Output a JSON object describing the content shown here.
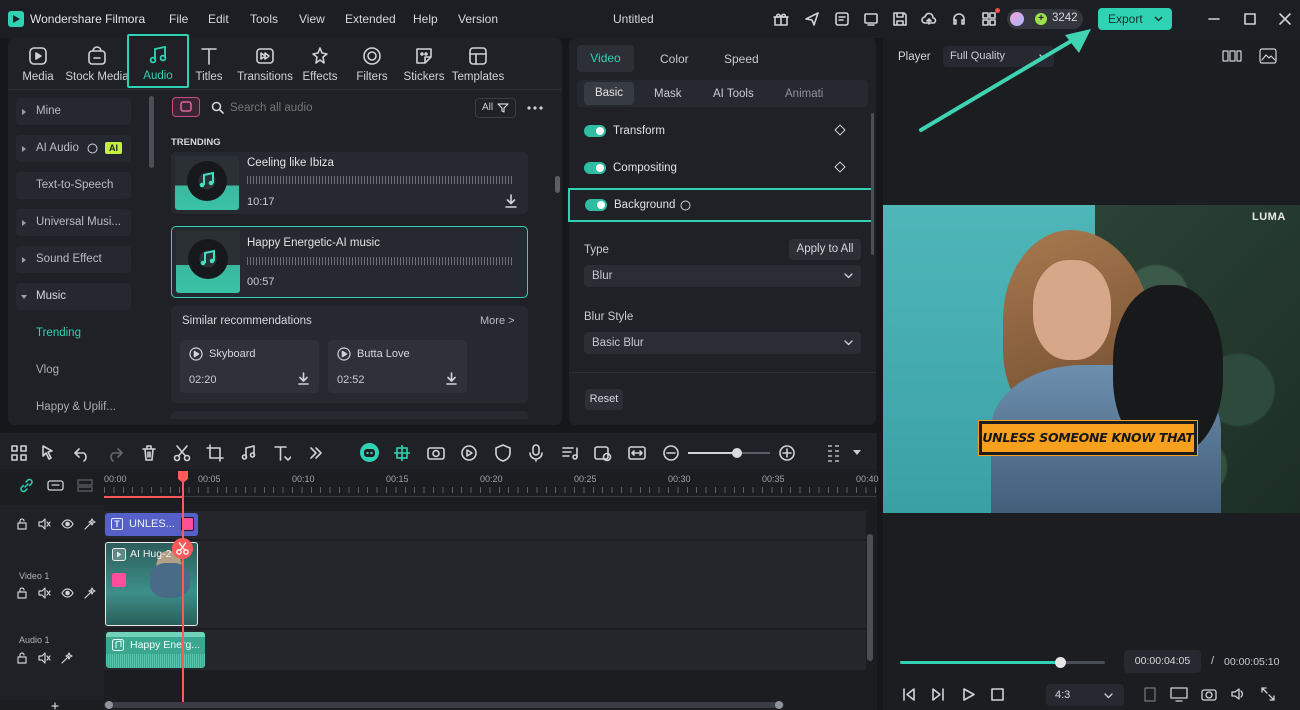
{
  "app": {
    "name": "Wondershare Filmora",
    "project_title": "Untitled",
    "credits": "3242",
    "export_label": "Export"
  },
  "menu": [
    "File",
    "Edit",
    "Tools",
    "View",
    "Extended",
    "Help",
    "Version"
  ],
  "toolbar": [
    {
      "label": "Media",
      "icon": "media-icon"
    },
    {
      "label": "Stock Media",
      "icon": "stock-media-icon"
    },
    {
      "label": "Audio",
      "icon": "music-note-icon",
      "active": true
    },
    {
      "label": "Titles",
      "icon": "text-t-icon"
    },
    {
      "label": "Transitions",
      "icon": "transitions-icon"
    },
    {
      "label": "Effects",
      "icon": "effects-icon"
    },
    {
      "label": "Filters",
      "icon": "filters-icon"
    },
    {
      "label": "Stickers",
      "icon": "stickers-icon"
    },
    {
      "label": "Templates",
      "icon": "templates-icon"
    }
  ],
  "sidebar": {
    "items": [
      {
        "label": "Mine",
        "kind": "collapsed"
      },
      {
        "label": "AI Audio",
        "kind": "collapsed",
        "badge": "AI"
      },
      {
        "label": "Text-to-Speech",
        "kind": "plain"
      },
      {
        "label": "Universal Musi...",
        "kind": "collapsed"
      },
      {
        "label": "Sound Effect",
        "kind": "collapsed"
      },
      {
        "label": "Music",
        "kind": "expanded"
      },
      {
        "label": "Trending",
        "kind": "sub-active"
      },
      {
        "label": "Vlog",
        "kind": "sub"
      },
      {
        "label": "Happy & Uplif...",
        "kind": "sub"
      }
    ]
  },
  "audio_browser": {
    "search_placeholder": "Search all audio",
    "filter_label": "All",
    "section_title": "TRENDING",
    "tracks": [
      {
        "title": "Ceeling like Ibiza",
        "duration": "10:17"
      },
      {
        "title": "Happy Energetic-AI music",
        "duration": "00:57"
      }
    ],
    "similar": {
      "title": "Similar recommendations",
      "more": "More >",
      "items": [
        {
          "title": "Skyboard",
          "duration": "02:20"
        },
        {
          "title": "Butta Love",
          "duration": "02:52"
        }
      ]
    }
  },
  "properties": {
    "tabs": [
      "Video",
      "Color",
      "Speed"
    ],
    "subtabs": [
      "Basic",
      "Mask",
      "AI Tools",
      "Animati"
    ],
    "rows": [
      {
        "label": "Transform"
      },
      {
        "label": "Compositing"
      },
      {
        "label": "Background"
      }
    ],
    "type_label": "Type",
    "apply_all": "Apply to All",
    "type_value": "Blur",
    "blur_style_label": "Blur Style",
    "blur_style_value": "Basic Blur",
    "reset": "Reset"
  },
  "player": {
    "label": "Player",
    "quality": "Full Quality",
    "watermark": "LUMA",
    "caption": "UNLESS SOMEONE KNOW THAT",
    "current_time": "00:00:04:05",
    "total_time": "00:00:05:10",
    "separator": "/",
    "aspect": "4:3",
    "progress": 0.78
  },
  "timeline": {
    "ruler": [
      "00:00",
      "00:05",
      "00:10",
      "00:15",
      "00:20",
      "00:25",
      "00:30",
      "00:35",
      "00:40"
    ],
    "tracks": [
      {
        "label": ""
      },
      {
        "label": "Video 1"
      },
      {
        "label": "Audio 1"
      }
    ],
    "clips": {
      "title": "UNLES...",
      "video": "AI Hug-2",
      "audio": "Happy Energ..."
    },
    "zoom": 0.6
  },
  "colors": {
    "accent": "#2fd3b4",
    "playhead": "#ff5a5a",
    "title_clip": "#5560c9",
    "audio_clip": "#3aa78e"
  }
}
